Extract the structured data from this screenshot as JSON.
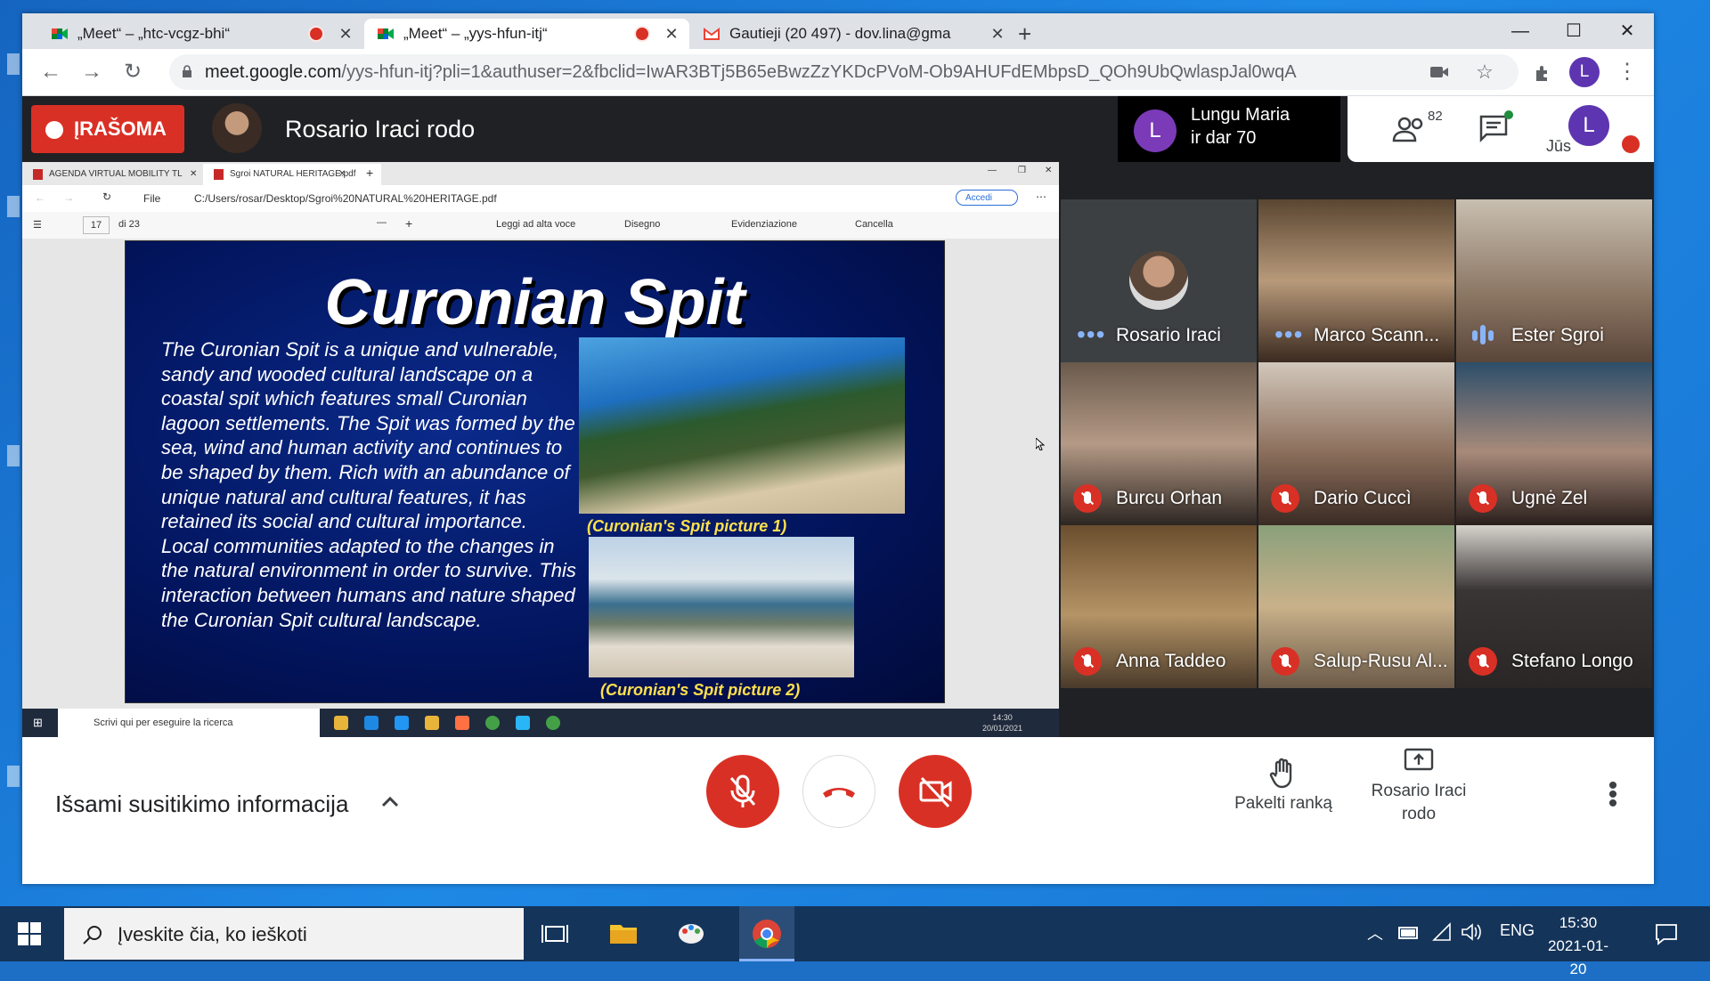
{
  "browser": {
    "tabs": [
      {
        "title": "„Meet“ – „htc-vcgz-bhi“"
      },
      {
        "title": "„Meet“ – „yys-hfun-itj“"
      },
      {
        "title": "Gautieji (20 497) - dov.lina@gma"
      }
    ],
    "url_host": "meet.google.com",
    "url_path": "/yys-hfun-itj?pli=1&authuser=2&fbclid=IwAR3BTj5B65eBwzZzYKDcPVoM-Ob9AHUFdEMbpsD_QOh9UbQwlaspJal0wqA",
    "profile_initial": "L"
  },
  "meet": {
    "recording_label": "ĮRAŠOMA",
    "presenter_banner": "Rosario Iraci rodo",
    "chat_popup": {
      "initial": "L",
      "name": "Lungu Maria",
      "sub": "ir dar 70"
    },
    "people_count": "82",
    "self_label": "Jūs",
    "self_initial": "L",
    "participants": [
      {
        "name": "Rosario Iraci",
        "state": "speaking-dots"
      },
      {
        "name": "Marco Scann...",
        "state": "speaking-dots"
      },
      {
        "name": "Ester Sgroi",
        "state": "speaking-bars"
      },
      {
        "name": "Burcu Orhan",
        "state": "muted"
      },
      {
        "name": "Dario Cuccì",
        "state": "muted"
      },
      {
        "name": "Ugnė Zel",
        "state": "muted"
      },
      {
        "name": "Anna Taddeo",
        "state": "muted"
      },
      {
        "name": "Salup-Rusu Al...",
        "state": "muted"
      },
      {
        "name": "Stefano Longo",
        "state": "muted"
      }
    ],
    "meeting_info": "Išsami susitikimo informacija",
    "raise_hand": "Pakelti ranką",
    "presenting_line1": "Rosario Iraci",
    "presenting_line2": "rodo"
  },
  "shared_screen": {
    "tabs": [
      "AGENDA VIRTUAL MOBILITY TL",
      "Sgroi NATURAL HERITAGE.pdf"
    ],
    "file_label": "File",
    "path": "C:/Users/rosar/Desktop/Sgroi%20NATURAL%20HERITAGE.pdf",
    "accedi": "Accedi",
    "page_current": "17",
    "page_total": "di 23",
    "read_aloud": "Leggi ad alta voce",
    "draw": "Disegno",
    "highlight": "Evidenziazione",
    "erase": "Cancella",
    "slide_title": "Curonian Spit",
    "slide_body": "The Curonian Spit is a unique and vulnerable, sandy and wooded cultural landscape on a coastal spit which features small Curonian lagoon settlements. The Spit was formed by the sea, wind and human activity and continues to be shaped by them. Rich with an abundance of unique natural and cultural features, it has retained its social and cultural importance. Local communities adapted to the changes in the natural environment in order to survive. This interaction between humans and nature shaped the Curonian Spit cultural landscape.",
    "caption1": "(Curonian's Spit picture 1)",
    "caption2": "(Curonian's Spit picture 2)",
    "taskbar_search": "Scrivi qui per eseguire la ricerca",
    "time": "14:30",
    "date": "20/01/2021"
  },
  "taskbar": {
    "search_placeholder": "Įveskite čia, ko ieškoti",
    "lang": "ENG",
    "time": "15:30",
    "date": "2021-01-20"
  }
}
